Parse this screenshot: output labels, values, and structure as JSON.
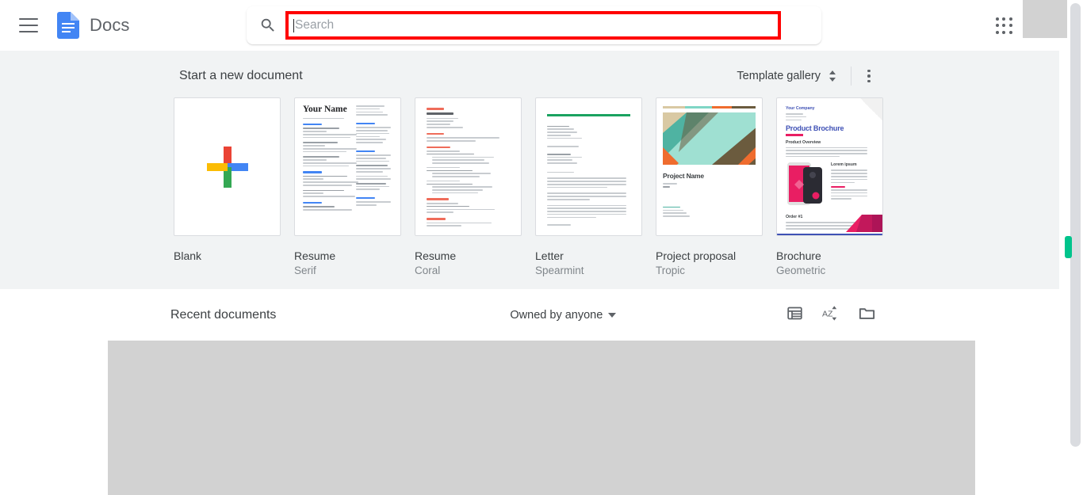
{
  "topbar": {
    "menu_icon": "hamburger-menu-icon",
    "logo_icon": "google-docs-logo-icon",
    "app_title": "Docs",
    "search_icon": "search-icon",
    "search_placeholder": "Search",
    "search_value": "",
    "search_highlight_color": "#ff0000",
    "apps_icon": "google-apps-grid-icon",
    "avatar": "account-avatar"
  },
  "templates_section": {
    "heading": "Start a new document",
    "gallery_label": "Template gallery",
    "gallery_toggle_icon": "chevron-up-down-icon",
    "more_icon": "more-vertical-icon",
    "background": "#f1f3f4",
    "cards": [
      {
        "name": "Blank",
        "sub": "",
        "thumb": "blank-plus-thumbnail"
      },
      {
        "name": "Resume",
        "sub": "Serif",
        "thumb": "resume-serif-thumbnail"
      },
      {
        "name": "Resume",
        "sub": "Coral",
        "thumb": "resume-coral-thumbnail"
      },
      {
        "name": "Letter",
        "sub": "Spearmint",
        "thumb": "letter-spearmint-thumbnail"
      },
      {
        "name": "Project proposal",
        "sub": "Tropic",
        "thumb": "project-proposal-tropic-thumbnail"
      },
      {
        "name": "Brochure",
        "sub": "Geometric",
        "thumb": "brochure-geometric-thumbnail"
      }
    ]
  },
  "thumbnail_text": {
    "resume_serif_name": "Your Name",
    "brochure_company": "Your Company",
    "brochure_title": "Product Brochure",
    "brochure_overview": "Product Overview",
    "brochure_specs": "Lorem ipsum",
    "brochure_footer": "Order #1",
    "project_title": "Project Name"
  },
  "recent_section": {
    "heading": "Recent documents",
    "owner_filter": "Owned by anyone",
    "owner_caret_icon": "caret-down-icon",
    "list_view_icon": "list-view-icon",
    "sort_icon": "sort-az-icon",
    "folder_icon": "open-folder-icon"
  },
  "colors": {
    "docs_blue": "#4285f4",
    "google_red": "#ea4335",
    "google_yellow": "#fbbc04",
    "google_green": "#34a853",
    "highlight_red": "#ff0000",
    "scroll_indicator_green": "#00c48c",
    "band_gray": "#f1f3f4",
    "placeholder_gray": "#d2d2d2"
  }
}
